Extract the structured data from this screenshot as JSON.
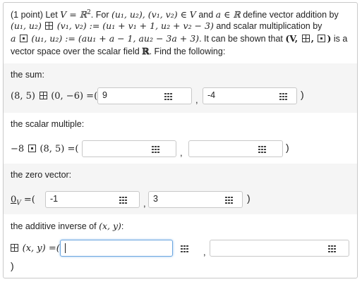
{
  "problem": {
    "points": "(1 point)",
    "line1_a": "Let",
    "line1_b": "V = ℝ",
    "line1_sup": "2",
    "line1_c": ". For",
    "line1_d": "(u₁, u₂), (v₁, v₂) ∈ V",
    "line1_e": "and",
    "line1_f": "a ∈ ℝ",
    "line1_g": "define vector addition by",
    "line2_a": "(u₁, u₂)",
    "line2_b": "(v₁, v₂) := (u₁ + v₁ + 1, u₂ + v₂ − 3)",
    "line2_c": "and scalar multiplication by",
    "line3_a": "a",
    "line3_b": "(u₁, u₂) := (au₁ + a − 1, au₂ − 3a + 3)",
    "line3_c": ". It can be shown that",
    "line3_d": "(V,",
    "line3_e": ",",
    "line3_f": ")",
    "line3_g": "is a",
    "line4_a": "vector space over the scalar field",
    "line4_b": "ℝ",
    "line4_c": ". Find the following:"
  },
  "sum": {
    "label": "the sum:",
    "expr_left": "(8, 5)",
    "expr_right": "(0, −6) =(",
    "field1_value": "9",
    "field2_value": "-4",
    "close": ")"
  },
  "scalar": {
    "label": "the scalar multiple:",
    "expr_left": "−8",
    "expr_right": "(8, 5) =(",
    "field1_value": "",
    "field2_value": "",
    "close": ")"
  },
  "zero": {
    "label": "the zero vector:",
    "expr_main": "0",
    "expr_sub": "V",
    "expr_rest": " =(",
    "field1_value": "-1",
    "field2_value": "3",
    "close": ")"
  },
  "inverse": {
    "label": "the additive inverse of",
    "label_math": "(x, y)",
    "label_end": ":",
    "expr_right": "(x, y) =(",
    "field1_value": "",
    "field2_value": "",
    "close": ")"
  },
  "comma": ",",
  "icons": [
    "matrix-grid-icon",
    "boxplus-symbol",
    "boxdot-symbol"
  ]
}
